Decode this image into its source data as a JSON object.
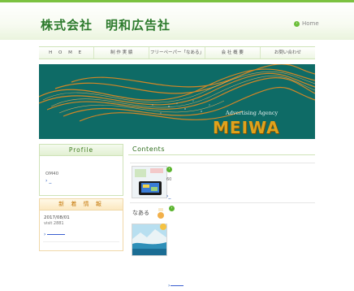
{
  "header": {
    "brand": "株式会社　明和広告社",
    "home_label": "Home"
  },
  "nav": {
    "items": [
      {
        "label": "H O M E"
      },
      {
        "label": "制 作 実 績"
      },
      {
        "label": "フリーペーパー「なある」"
      },
      {
        "label": "会 社 概 要"
      },
      {
        "label": "お問い合わせ"
      }
    ]
  },
  "banner": {
    "tagline": "Advertising Agency",
    "logo": "MEIWA"
  },
  "profile": {
    "title": "Profile",
    "text": "OM40",
    "link": "_"
  },
  "news": {
    "title": "新 着 情 報",
    "date": "2017/08/01",
    "visit": "visit 2881",
    "link": ""
  },
  "contents": {
    "title": "Contents",
    "item1_meta": "60",
    "item1_link": "_",
    "item2_label": "なある"
  },
  "footer": {
    "link": ""
  },
  "colors": {
    "accent_green": "#7cc242",
    "banner_teal": "#0e6b66",
    "logo_gold": "#e0a21c",
    "news_orange": "#c77c10"
  }
}
